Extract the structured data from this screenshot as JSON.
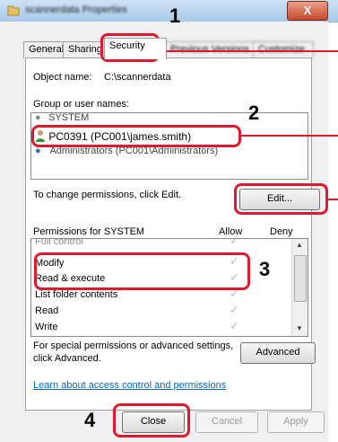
{
  "window": {
    "title": "scannerdata Properties",
    "close_glyph": "X"
  },
  "tabs": [
    {
      "label": "General"
    },
    {
      "label": "Sharing"
    },
    {
      "label": "Security"
    },
    {
      "label": "Previous Versions"
    },
    {
      "label": "Customize"
    }
  ],
  "object_name": {
    "label": "Object name:",
    "value": "C:\\scannerdata"
  },
  "groups": {
    "label": "Group or user names:",
    "items": [
      "SYSTEM",
      "PC0391 (PC001\\james.smith)",
      "Administrators (PC001\\Administrators)"
    ]
  },
  "change_permissions": {
    "label": "To change permissions, click Edit.",
    "edit_button": "Edit..."
  },
  "permissions": {
    "header": "Permissions for SYSTEM",
    "allow_col": "Allow",
    "deny_col": "Deny",
    "rows": [
      "Full control",
      "Modify",
      "Read & execute",
      "List folder contents",
      "Read",
      "Write"
    ]
  },
  "special": {
    "text_line1": "For special permissions or advanced settings,",
    "text_line2": "click Advanced.",
    "advanced_button": "Advanced"
  },
  "learn_link": "Learn about access control and permissions",
  "footer": {
    "close": "Close",
    "cancel": "Cancel",
    "apply": "Apply"
  },
  "callouts": [
    "1",
    "2",
    "3",
    "4"
  ],
  "colors": {
    "callout_red": "#e0192e",
    "link_blue": "#0066cc"
  }
}
